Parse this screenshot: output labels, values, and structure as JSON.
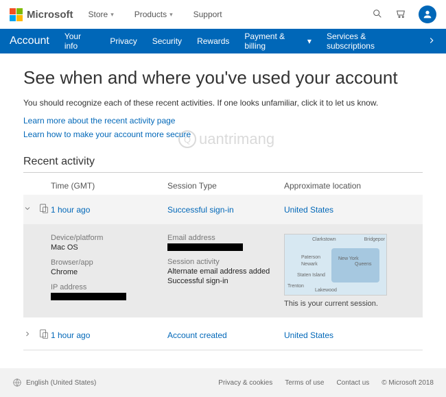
{
  "topbar": {
    "brand": "Microsoft",
    "links": {
      "store": "Store",
      "products": "Products",
      "support": "Support"
    }
  },
  "nav": {
    "brand": "Account",
    "items": {
      "info": "Your info",
      "privacy": "Privacy",
      "security": "Security",
      "rewards": "Rewards",
      "payment": "Payment & billing",
      "subs": "Services & subscriptions"
    }
  },
  "page": {
    "title": "See when and where you've used your account",
    "subtitle": "You should recognize each of these recent activities. If one looks unfamiliar, click it to let us know.",
    "learn_more": "Learn more about the recent activity page",
    "learn_secure": "Learn how to make your account more secure"
  },
  "activity": {
    "section": "Recent activity",
    "headers": {
      "time": "Time (GMT)",
      "type": "Session Type",
      "location": "Approximate location"
    },
    "rows": [
      {
        "time": "1 hour ago",
        "type": "Successful sign-in",
        "location": "United States",
        "expanded": true
      },
      {
        "time": "1 hour ago",
        "type": "Account created",
        "location": "United States",
        "expanded": false
      }
    ],
    "detail": {
      "device_label": "Device/platform",
      "device_value": "Mac OS",
      "browser_label": "Browser/app",
      "browser_value": "Chrome",
      "ip_label": "IP address",
      "email_label": "Email address",
      "session_label": "Session activity",
      "session_line1": "Alternate email address added",
      "session_line2": "Successful sign-in",
      "map_caption": "This is your current session.",
      "map_places": {
        "clarkstown": "Clarkstown",
        "bridgeport": "Bridgepor",
        "paterson": "Paterson",
        "newark": "Newark",
        "ny": "New York",
        "queens": "Queens",
        "staten": "Staten Island",
        "trenton": "Trenton",
        "lakewood": "Lakewood"
      }
    }
  },
  "footer": {
    "lang": "English (United States)",
    "links": {
      "privacy": "Privacy & cookies",
      "terms": "Terms of use",
      "contact": "Contact us"
    },
    "copyright": "© Microsoft 2018"
  },
  "watermark": {
    "text": "uantrimang",
    "glyph": "Q"
  }
}
